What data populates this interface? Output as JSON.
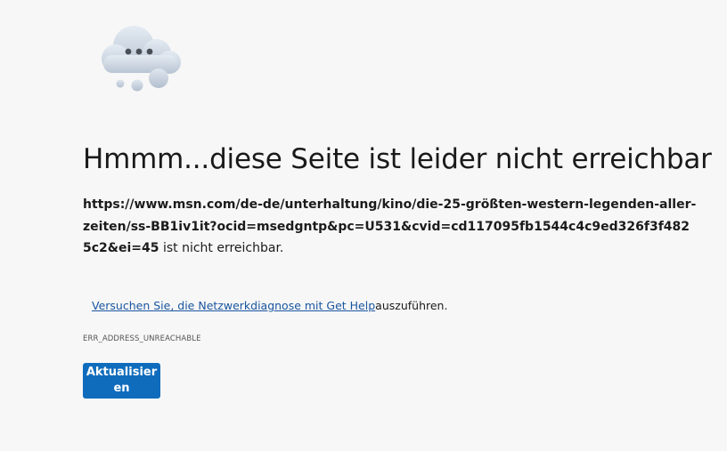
{
  "error_page": {
    "title": "Hmmm...diese Seite ist leider nicht erreichbar",
    "url": "https://www.msn.com/de-de/unterhaltung/kino/die-25-größten-western-legenden-aller-zeiten/ss-BB1iv1it?ocid=msedgntp&pc=U531&cvid=cd117095fb1544c4c9ed326f3f4825c2&ei=45",
    "unreachable_suffix": " ist nicht erreichbar.",
    "suggestion_link": "Versuchen Sie, die Netzwerkdiagnose mit Get Help",
    "suggestion_suffix": "auszuführen.",
    "error_code": "ERR_ADDRESS_UNREACHABLE",
    "reload_label": "Aktualisieren"
  },
  "icons": {
    "illustration": "cloud-icon"
  },
  "colors": {
    "background": "#f7f7f7",
    "button": "#0f6cbd",
    "link": "#1a56a0"
  }
}
